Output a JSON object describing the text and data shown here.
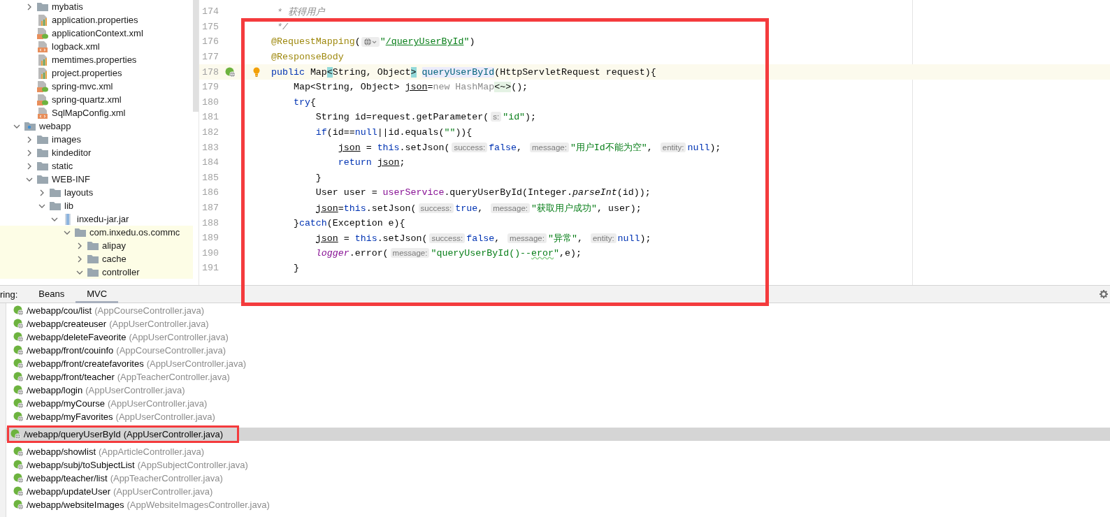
{
  "tree": {
    "items": [
      {
        "children": [
          {
            "label": "mybatis",
            "kind": "folder",
            "expanded": false
          },
          {
            "label": "application.properties",
            "kind": "properties"
          },
          {
            "label": "applicationContext.xml",
            "kind": "spring-xml"
          },
          {
            "label": "logback.xml",
            "kind": "xml"
          },
          {
            "label": "memtimes.properties",
            "kind": "properties"
          },
          {
            "label": "project.properties",
            "kind": "properties"
          },
          {
            "label": "spring-mvc.xml",
            "kind": "spring-xml"
          },
          {
            "label": "spring-quartz.xml",
            "kind": "spring-xml"
          },
          {
            "label": "SqlMapConfig.xml",
            "kind": "xml"
          }
        ]
      },
      {
        "label": "webapp",
        "kind": "web-folder",
        "expanded": true,
        "children": [
          {
            "label": "images",
            "kind": "folder",
            "expanded": false
          },
          {
            "label": "kindeditor",
            "kind": "folder",
            "expanded": false
          },
          {
            "label": "static",
            "kind": "folder",
            "expanded": false
          },
          {
            "label": "WEB-INF",
            "kind": "folder",
            "expanded": true,
            "children": [
              {
                "label": "layouts",
                "kind": "folder",
                "expanded": false
              },
              {
                "label": "lib",
                "kind": "folder",
                "expanded": true,
                "children": [
                  {
                    "label": "inxedu-jar.jar",
                    "kind": "jar",
                    "expanded": true,
                    "children": [
                      {
                        "label": "com.inxedu.os.commc",
                        "kind": "package",
                        "expanded": true,
                        "library": true,
                        "children": [
                          {
                            "label": "alipay",
                            "kind": "folder",
                            "expanded": false,
                            "library": true
                          },
                          {
                            "label": "cache",
                            "kind": "folder",
                            "expanded": false,
                            "library": true
                          },
                          {
                            "label": "controller",
                            "kind": "folder",
                            "expanded": true,
                            "library": true
                          }
                        ]
                      }
                    ]
                  }
                ]
              }
            ]
          }
        ]
      }
    ]
  },
  "editor": {
    "boxed": true,
    "lines": [
      {
        "number": "174",
        "current": false,
        "tokens": [
          {
            "comment": " * 获得用户"
          }
        ]
      },
      {
        "number": "175",
        "current": false,
        "tokens": [
          {
            "comment": " */"
          }
        ]
      },
      {
        "number": "176",
        "current": false,
        "tokens": [
          {
            "ann": "@RequestMapping"
          },
          {
            "plain": "("
          },
          {
            "globe_hint": true
          },
          {
            "str": "\""
          },
          {
            "link": "/queryUserById"
          },
          {
            "str": "\""
          },
          {
            "plain": ")"
          }
        ]
      },
      {
        "number": "177",
        "current": false,
        "tokens": [
          {
            "ann": "@ResponseBody"
          }
        ]
      },
      {
        "number": "178",
        "current": true,
        "run_marker": true,
        "bulb": true,
        "tokens": [
          {
            "kw": "public"
          },
          {
            "plain": " Map"
          },
          {
            "match": "<"
          },
          {
            "plain": "String, Object"
          },
          {
            "match": ">"
          },
          {
            "decl": " queryUserById"
          },
          {
            "plain": "(HttpServletRequest request){"
          }
        ]
      },
      {
        "number": "179",
        "current": false,
        "tokens": [
          {
            "plain": "    Map<String, Object> "
          },
          {
            "var": "json"
          },
          {
            "plain": "="
          },
          {
            "faded": "new HashMap"
          },
          {
            "fold": "<~>"
          },
          {
            "plain": "();"
          }
        ]
      },
      {
        "number": "180",
        "current": false,
        "tokens": [
          {
            "kw": "    try"
          },
          {
            "plain": "{"
          }
        ]
      },
      {
        "number": "181",
        "current": false,
        "tokens": [
          {
            "plain": "        String id=request.getParameter("
          },
          {
            "hint": "s:"
          },
          {
            "str": "\"id\""
          },
          {
            "plain": ");"
          }
        ]
      },
      {
        "number": "182",
        "current": false,
        "tokens": [
          {
            "kw": "        if"
          },
          {
            "plain": "(id=="
          },
          {
            "kw": "null"
          },
          {
            "plain": "||id.equals("
          },
          {
            "str": "\"\""
          },
          {
            "plain": ")){"
          }
        ]
      },
      {
        "number": "183",
        "current": false,
        "tokens": [
          {
            "var": "            json"
          },
          {
            "plain": " = "
          },
          {
            "kw": "this"
          },
          {
            "plain": ".setJson("
          },
          {
            "hint": "success:"
          },
          {
            "kw": "false"
          },
          {
            "plain": ", "
          },
          {
            "hint": "message:"
          },
          {
            "str": "\"用户Id不能为空\""
          },
          {
            "plain": ", "
          },
          {
            "hint": "entity:"
          },
          {
            "kw": "null"
          },
          {
            "plain": ");"
          }
        ]
      },
      {
        "number": "184",
        "current": false,
        "tokens": [
          {
            "kw": "            return "
          },
          {
            "var": "json"
          },
          {
            "plain": ";"
          }
        ]
      },
      {
        "number": "185",
        "current": false,
        "tokens": [
          {
            "plain": "        }"
          }
        ]
      },
      {
        "number": "186",
        "current": false,
        "tokens": [
          {
            "plain": "        User user = "
          },
          {
            "field": "userService"
          },
          {
            "plain": ".queryUserById(Integer."
          },
          {
            "static": "parseInt"
          },
          {
            "plain": "(id));"
          }
        ]
      },
      {
        "number": "187",
        "current": false,
        "tokens": [
          {
            "var": "        json"
          },
          {
            "plain": "="
          },
          {
            "kw": "this"
          },
          {
            "plain": ".setJson("
          },
          {
            "hint": "success:"
          },
          {
            "kw": "true"
          },
          {
            "plain": ", "
          },
          {
            "hint": "message:"
          },
          {
            "str": "\"获取用户成功\""
          },
          {
            "plain": ", user);"
          }
        ]
      },
      {
        "number": "188",
        "current": false,
        "tokens": [
          {
            "plain": "    }"
          },
          {
            "kw": "catch"
          },
          {
            "plain": "(Exception e){"
          }
        ]
      },
      {
        "number": "189",
        "current": false,
        "tokens": [
          {
            "var": "        json"
          },
          {
            "plain": " = "
          },
          {
            "kw": "this"
          },
          {
            "plain": ".setJson("
          },
          {
            "hint": "success:"
          },
          {
            "kw": "false"
          },
          {
            "plain": ", "
          },
          {
            "hint": "message:"
          },
          {
            "str": "\"异常\""
          },
          {
            "plain": ", "
          },
          {
            "hint": "entity:"
          },
          {
            "kw": "null"
          },
          {
            "plain": ");"
          }
        ]
      },
      {
        "number": "190",
        "current": false,
        "tokens": [
          {
            "static_field": "        logger"
          },
          {
            "plain": ".error("
          },
          {
            "hint": "message:"
          },
          {
            "str": "\"queryUserById()--"
          },
          {
            "typo": "eror"
          },
          {
            "str": "\""
          },
          {
            "plain": ",e);"
          }
        ]
      },
      {
        "number": "191",
        "current": false,
        "tokens": [
          {
            "plain": "    }"
          }
        ]
      }
    ]
  },
  "bottom_panel": {
    "label": "ring:",
    "tabs": [
      {
        "label": "Beans",
        "selected": false
      },
      {
        "label": "MVC",
        "selected": true
      }
    ],
    "mappings": [
      {
        "path": "/webapp/cou/list",
        "file": "(AppCourseController.java)",
        "selected": false,
        "boxed": false
      },
      {
        "path": "/webapp/createuser",
        "file": "(AppUserController.java)",
        "selected": false,
        "boxed": false
      },
      {
        "path": "/webapp/deleteFaveorite",
        "file": "(AppUserController.java)",
        "selected": false,
        "boxed": false
      },
      {
        "path": "/webapp/front/couinfo",
        "file": "(AppCourseController.java)",
        "selected": false,
        "boxed": false
      },
      {
        "path": "/webapp/front/createfavorites",
        "file": "(AppUserController.java)",
        "selected": false,
        "boxed": false
      },
      {
        "path": "/webapp/front/teacher",
        "file": "(AppTeacherController.java)",
        "selected": false,
        "boxed": false
      },
      {
        "path": "/webapp/login",
        "file": "(AppUserController.java)",
        "selected": false,
        "boxed": false
      },
      {
        "path": "/webapp/myCourse",
        "file": "(AppUserController.java)",
        "selected": false,
        "boxed": false
      },
      {
        "path": "/webapp/myFavorites",
        "file": "(AppUserController.java)",
        "selected": false,
        "boxed": false
      },
      {
        "path": "/webapp/queryUserById",
        "file": "(AppUserController.java)",
        "selected": true,
        "boxed": true
      },
      {
        "path": "/webapp/showlist",
        "file": "(AppArticleController.java)",
        "selected": false,
        "boxed": false
      },
      {
        "path": "/webapp/subj/toSubjectList",
        "file": "(AppSubjectController.java)",
        "selected": false,
        "boxed": false
      },
      {
        "path": "/webapp/teacher/list",
        "file": "(AppTeacherController.java)",
        "selected": false,
        "boxed": false
      },
      {
        "path": "/webapp/updateUser",
        "file": "(AppUserController.java)",
        "selected": false,
        "boxed": false
      },
      {
        "path": "/webapp/websiteImages",
        "file": "(AppWebsiteImagesController.java)",
        "selected": false,
        "boxed": false
      }
    ]
  }
}
